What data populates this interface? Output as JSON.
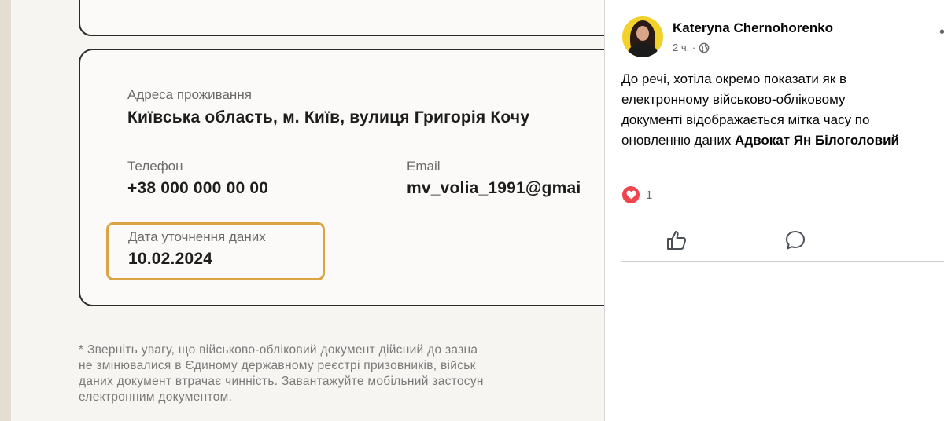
{
  "document": {
    "address_label": "Адреса проживання",
    "address_value": "Київська область, м. Київ, вулиця Григорія Кочу",
    "phone_label": "Телефон",
    "phone_value": "+38 000 000 00 00",
    "email_label": "Email",
    "email_value": "mv_volia_1991@gmai",
    "date_label": "Дата уточнення даних",
    "date_value": "10.02.2024",
    "note_lines": [
      "* Зверніть увагу, що військово-обліковий документ дійсний до зазна",
      "не змінювалися в Єдиному державному реєстрі призовників, військ",
      "даних документ втрачає чинність. Завантажуйте мобільний застосун",
      "електронним документом."
    ],
    "highlight_color": "#d9a441"
  },
  "post": {
    "author": "Kateryna Chernohorenko",
    "time": "2 ч. ·",
    "text_lines": [
      "До речі, хотіла окремо показати як в",
      "електронному військово-обліковому",
      "документі відображається мітка часу по"
    ],
    "text_last_prefix": "оновленню даних ",
    "text_mention": "Адвокат Ян Білоголовий",
    "reaction_count": "1",
    "icons": {
      "privacy": "globe-icon",
      "reaction": "love-reaction-icon",
      "like": "like-icon",
      "comment": "comment-icon",
      "more": "more-options-icon"
    },
    "colors": {
      "reaction": "#f0444f",
      "text": "#050505",
      "meta": "#65676b"
    }
  }
}
